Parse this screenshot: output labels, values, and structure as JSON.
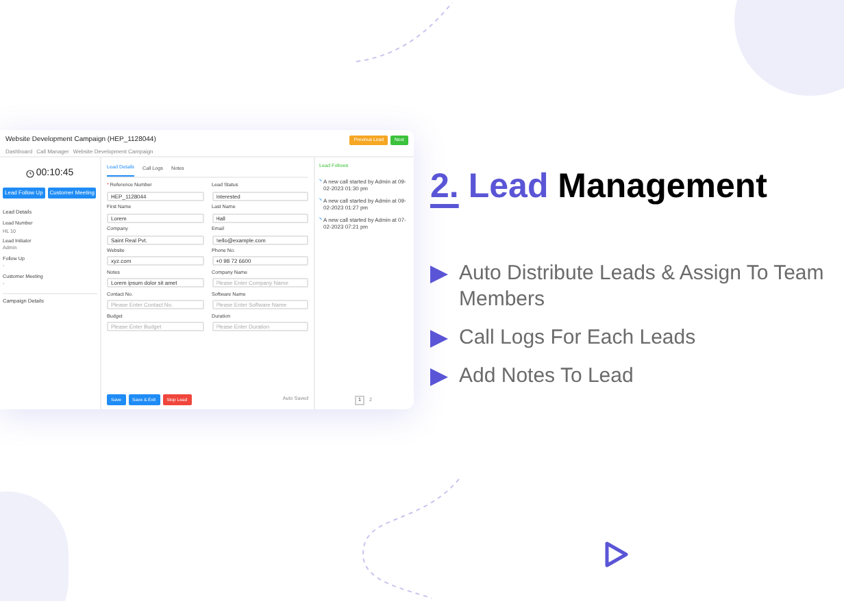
{
  "app": {
    "title": "Website Development Campaign (HEP_1128044)",
    "breadcrumb": [
      "Dashboard",
      "Call Manager",
      "Website Development Campaign"
    ],
    "header_buttons": [
      {
        "label": "Previous Lead",
        "kind": "warning"
      },
      {
        "label": "Next",
        "kind": "success"
      }
    ],
    "timer": "00:10:45",
    "left_buttons": [
      "Lead Follow Up",
      "Customer Meeting"
    ],
    "details_title": "Lead Details",
    "details": [
      {
        "label": "Lead Number",
        "value": "HL 10"
      },
      {
        "label": "Lead Initiator",
        "value": "Admin"
      },
      {
        "label": "Follow Up",
        "value": "-"
      },
      {
        "label": "Customer Meeting",
        "value": "-"
      }
    ],
    "campaign_title": "Campaign Details",
    "tabs": [
      {
        "label": "Lead Details",
        "selected": true
      },
      {
        "label": "Call Logs",
        "selected": false
      },
      {
        "label": "Notes",
        "selected": false
      }
    ],
    "fields": [
      {
        "label": "Reference Number",
        "value": "HEP_1128044",
        "required_mark": "*"
      },
      {
        "label": "Lead Status",
        "value": "Interested"
      },
      {
        "label": "First Name",
        "value": "Lorem"
      },
      {
        "label": "Last Name",
        "value": "Hall"
      },
      {
        "label": "Company",
        "value": "Saint Real Pvt."
      },
      {
        "label": "Email",
        "value": "hello@example.com"
      },
      {
        "label": "Website",
        "value": "xyz.com"
      },
      {
        "label": "Phone No.",
        "value": "+0 98 72 6600"
      },
      {
        "label": "Notes",
        "value": "Lorem ipsum dolor sit amet"
      },
      {
        "label": "Company Name",
        "placeholder": "Please Enter Company Name"
      },
      {
        "label": "Contact No.",
        "placeholder": "Please Enter Contact No."
      },
      {
        "label": "Software Name",
        "placeholder": "Please Enter Software Name"
      },
      {
        "label": "Budget",
        "placeholder": "Please Enter Budget"
      },
      {
        "label": "Duration",
        "placeholder": "Please Enter Duration"
      }
    ],
    "form_buttons": [
      {
        "label": "Save",
        "kind": "primary"
      },
      {
        "label": "Save & Exit",
        "kind": "primary"
      },
      {
        "label": "Stop Lead",
        "kind": "danger"
      }
    ],
    "auto_save": "Auto Saved",
    "side_title": "Lead Follows",
    "feed": [
      "A new call started by Admin at 09-02-2023 01:30 pm",
      "A new call started by Admin at 09-02-2023 01:27 pm",
      "A new call started by Admin at 07-02-2023 07:21 pm"
    ],
    "pages": [
      {
        "label": "1",
        "selected": true
      },
      {
        "label": "2",
        "selected": false
      }
    ]
  },
  "heading": {
    "number": "2.",
    "accent": "Lead",
    "rest": "Management"
  },
  "features": [
    "Auto Distribute Leads & Assign To Team Members",
    "Call Logs For Each Leads",
    "Add Notes To Lead"
  ]
}
